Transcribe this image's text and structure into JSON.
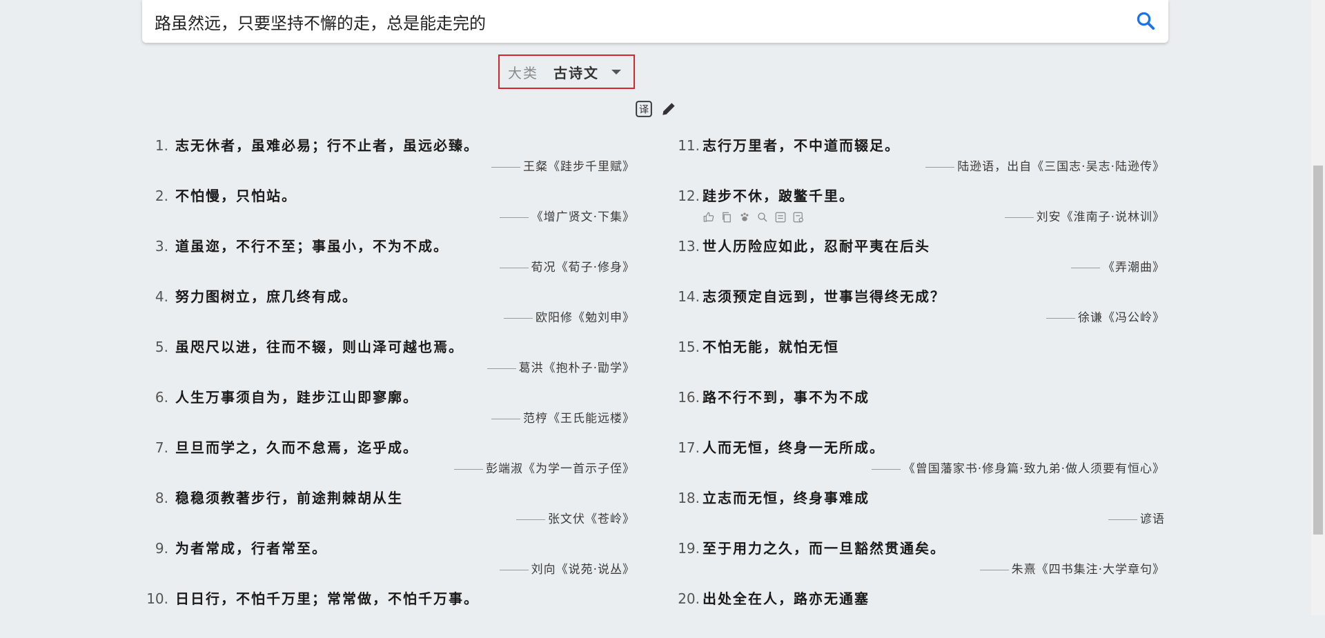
{
  "search": {
    "value": "路虽然远，只要坚持不懈的走，总是能走完的",
    "icon": "search-icon",
    "icon_color": "#1a73e8"
  },
  "category": {
    "label": "大类",
    "value": "古诗文",
    "icon": "caret-down-icon",
    "border_color": "#d9232b"
  },
  "tools": [
    "translate-icon",
    "pencil-icon"
  ],
  "left_items": [
    {
      "num": "1.",
      "text": "志无休者，虽难必易；行不止者，虽远必臻。",
      "source": "王粲《跬步千里赋》"
    },
    {
      "num": "2.",
      "text": "不怕慢，只怕站。",
      "source": "《增广贤文·下集》"
    },
    {
      "num": "3.",
      "text": "道虽迩，不行不至；事虽小，不为不成。",
      "source": "荀况《荀子·修身》"
    },
    {
      "num": "4.",
      "text": "努力图树立，庶几终有成。",
      "source": "欧阳修《勉刘申》"
    },
    {
      "num": "5.",
      "text": "虽咫尺以进，往而不辍，则山泽可越也焉。",
      "source": "葛洪《抱朴子·勖学》"
    },
    {
      "num": "6.",
      "text": "人生万事须自为，跬步江山即寥廓。",
      "source": "范梈《王氏能远楼》"
    },
    {
      "num": "7.",
      "text": "旦旦而学之，久而不怠焉，迄乎成。",
      "source": "彭端淑《为学一首示子侄》"
    },
    {
      "num": "8.",
      "text": "稳稳须教著步行，前途荆棘胡从生",
      "source": "张文伏《苍岭》"
    },
    {
      "num": "9.",
      "text": "为者常成，行者常至。",
      "source": "刘向《说苑·说丛》"
    },
    {
      "num": "10.",
      "text": "日日行，不怕千万里；常常做，不怕千万事。",
      "source": ""
    }
  ],
  "right_items": [
    {
      "num": "11.",
      "text": "志行万里者，不中道而辍足。",
      "source": "陆逊语，出自《三国志·吴志·陆逊传》"
    },
    {
      "num": "12.",
      "text": "跬步不休，跛鳖千里。",
      "source": "刘安《淮南子·说林训》",
      "actions": [
        "thumbs-up-icon",
        "copy-icon",
        "paw-icon",
        "search-icon",
        "translate-icon",
        "note-icon"
      ]
    },
    {
      "num": "13.",
      "text": "世人历险应如此，忍耐平夷在后头",
      "source": "《弄潮曲》"
    },
    {
      "num": "14.",
      "text": "志须预定自远到，世事岂得终无成？",
      "source": "徐谦《冯公岭》"
    },
    {
      "num": "15.",
      "text": "不怕无能，就怕无恒",
      "source": ""
    },
    {
      "num": "16.",
      "text": "路不行不到，事不为不成",
      "source": ""
    },
    {
      "num": "17.",
      "text": "人而无恒，终身一无所成。",
      "source": "《曾国藩家书·修身篇·致九弟·做人须要有恒心》"
    },
    {
      "num": "18.",
      "text": "立志而无恒，终身事难成",
      "source": "谚语"
    },
    {
      "num": "19.",
      "text": "至于用力之久，而一旦豁然贯通矣。",
      "source": "朱熹《四书集注·大学章句》"
    },
    {
      "num": "20.",
      "text": "出处全在人，路亦无通塞",
      "source": ""
    }
  ]
}
